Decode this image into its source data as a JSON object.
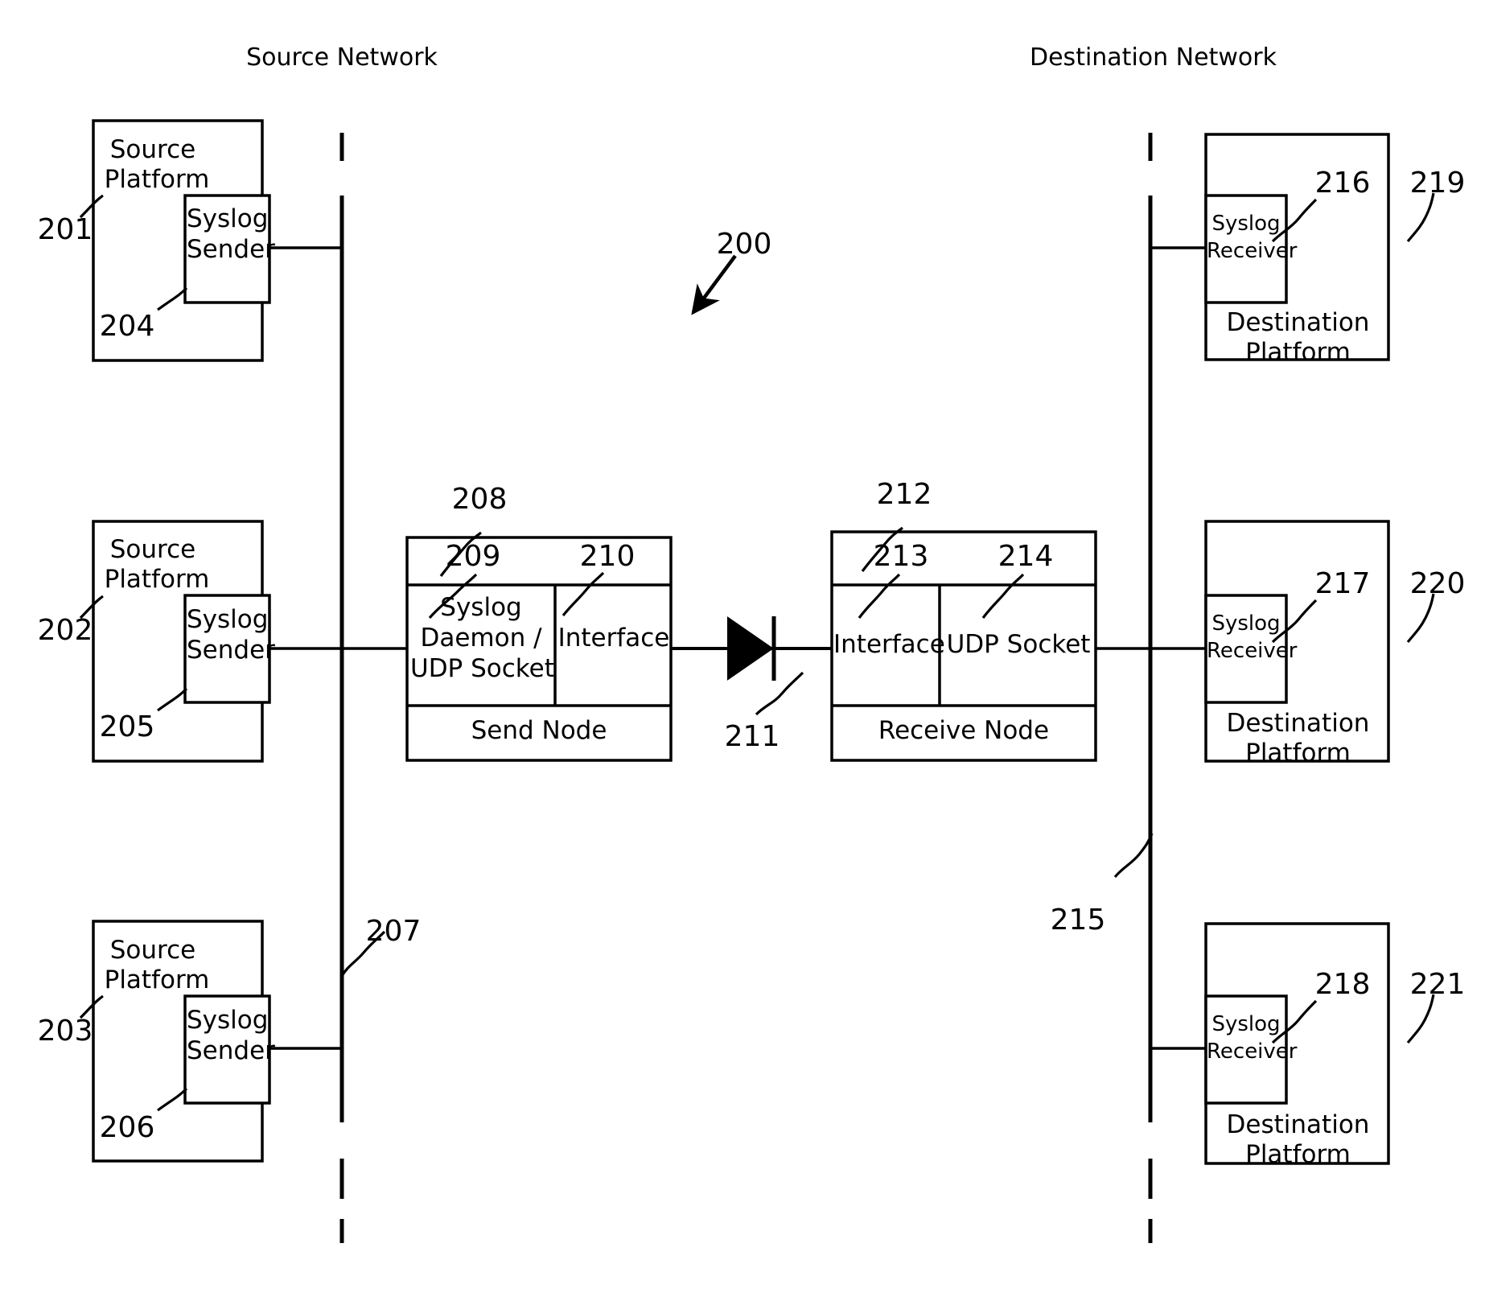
{
  "diagram": {
    "figure_ref": "200",
    "network_labels": {
      "source": "Source Network",
      "destination": "Destination Network"
    },
    "source_platforms": [
      {
        "ref": "201",
        "title_line1": "Source",
        "title_line2": "Platform",
        "inner_ref": "204",
        "inner_line1": "Syslog",
        "inner_line2": "Sender"
      },
      {
        "ref": "202",
        "title_line1": "Source",
        "title_line2": "Platform",
        "inner_ref": "205",
        "inner_line1": "Syslog",
        "inner_line2": "Sender"
      },
      {
        "ref": "203",
        "title_line1": "Source",
        "title_line2": "Platform",
        "inner_ref": "206",
        "inner_line1": "Syslog",
        "inner_line2": "Sender"
      }
    ],
    "destination_platforms": [
      {
        "ref": "219",
        "title_line1": "Destination",
        "title_line2": "Platform",
        "inner_ref": "216",
        "inner_line1": "Syslog",
        "inner_line2": "Receiver"
      },
      {
        "ref": "220",
        "title_line1": "Destination",
        "title_line2": "Platform",
        "inner_ref": "217",
        "inner_line1": "Syslog",
        "inner_line2": "Receiver"
      },
      {
        "ref": "221",
        "title_line1": "Destination",
        "title_line2": "Platform",
        "inner_ref": "218",
        "inner_line1": "Syslog",
        "inner_line2": "Receiver"
      }
    ],
    "send_node": {
      "ref": "208",
      "footer": "Send Node",
      "cells": [
        {
          "ref": "209",
          "line1": "Syslog",
          "line2": "Daemon /",
          "line3": "UDP Socket"
        },
        {
          "ref": "210",
          "line1": "Interface",
          "line2": "",
          "line3": ""
        }
      ]
    },
    "receive_node": {
      "ref": "212",
      "footer": "Receive Node",
      "cells": [
        {
          "ref": "213",
          "line1": "Interface",
          "line2": "",
          "line3": ""
        },
        {
          "ref": "214",
          "line1": "UDP Socket",
          "line2": "",
          "line3": ""
        }
      ]
    },
    "data_diode": {
      "ref": "211",
      "icon": "diode-symbol"
    },
    "bus_refs": {
      "source_bus": "207",
      "destination_bus": "215"
    },
    "colors": {
      "stroke": "#000000",
      "background": "#ffffff"
    }
  }
}
